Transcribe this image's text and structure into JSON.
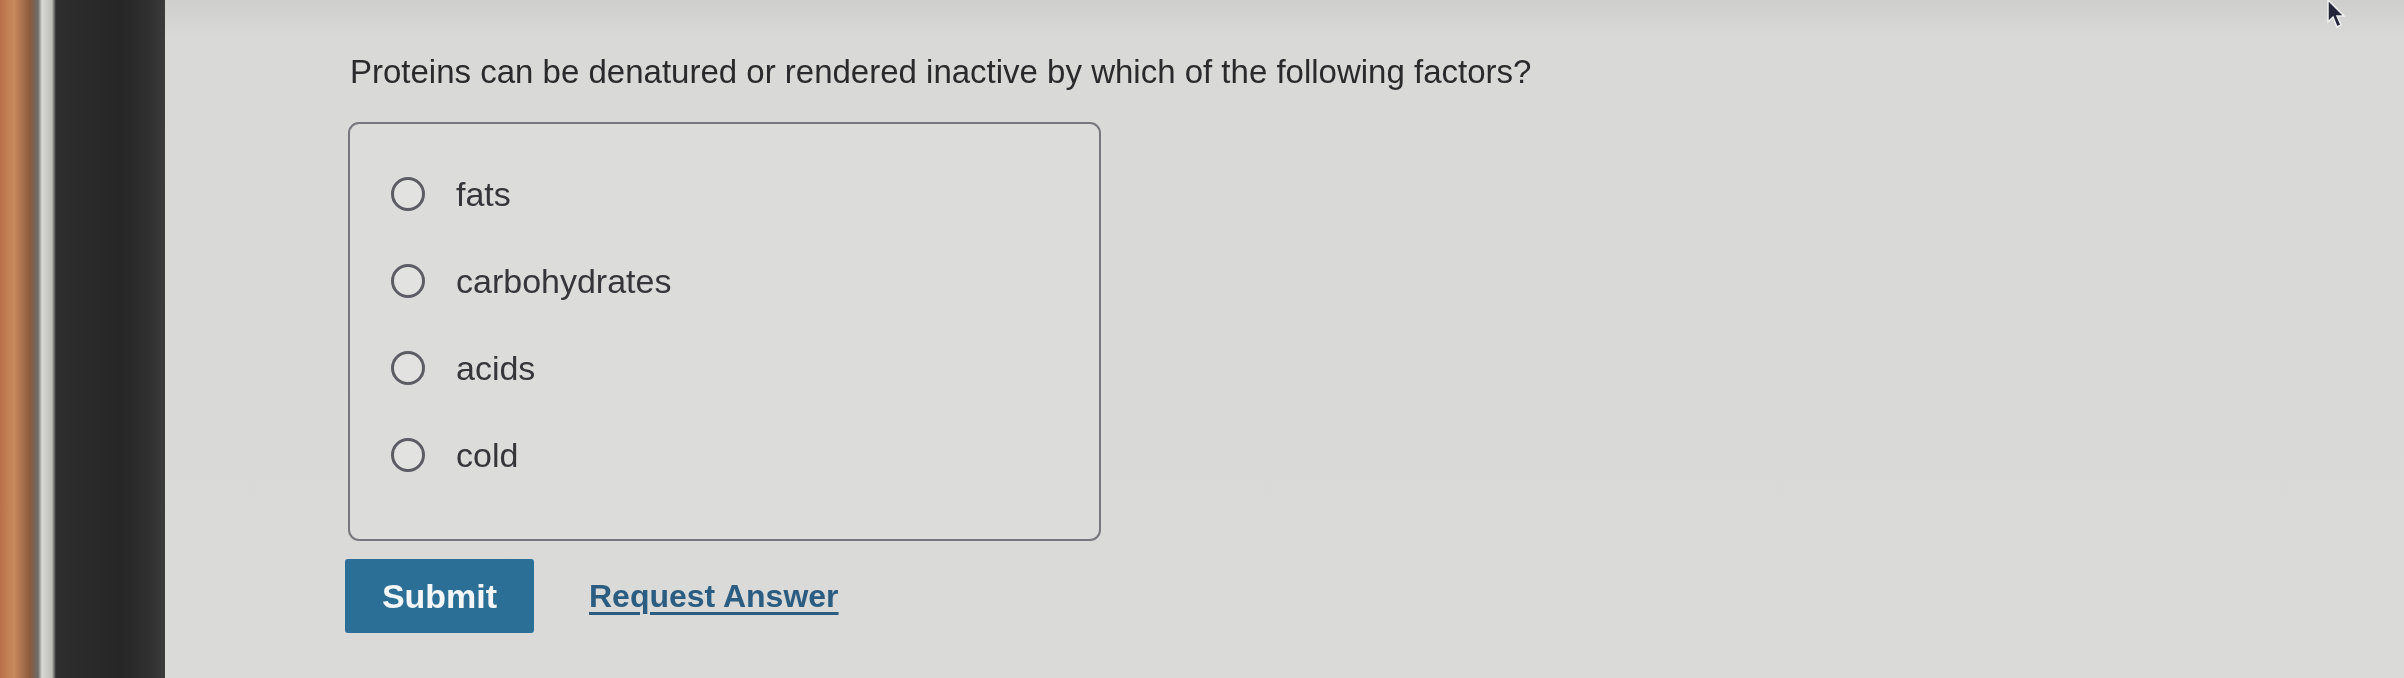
{
  "question": "Proteins can be denatured or rendered inactive by which of the following factors?",
  "options": [
    {
      "label": "fats",
      "selected": false
    },
    {
      "label": "carbohydrates",
      "selected": false
    },
    {
      "label": "acids",
      "selected": false
    },
    {
      "label": "cold",
      "selected": false
    }
  ],
  "actions": {
    "submit": "Submit",
    "request_answer": "Request Answer"
  }
}
